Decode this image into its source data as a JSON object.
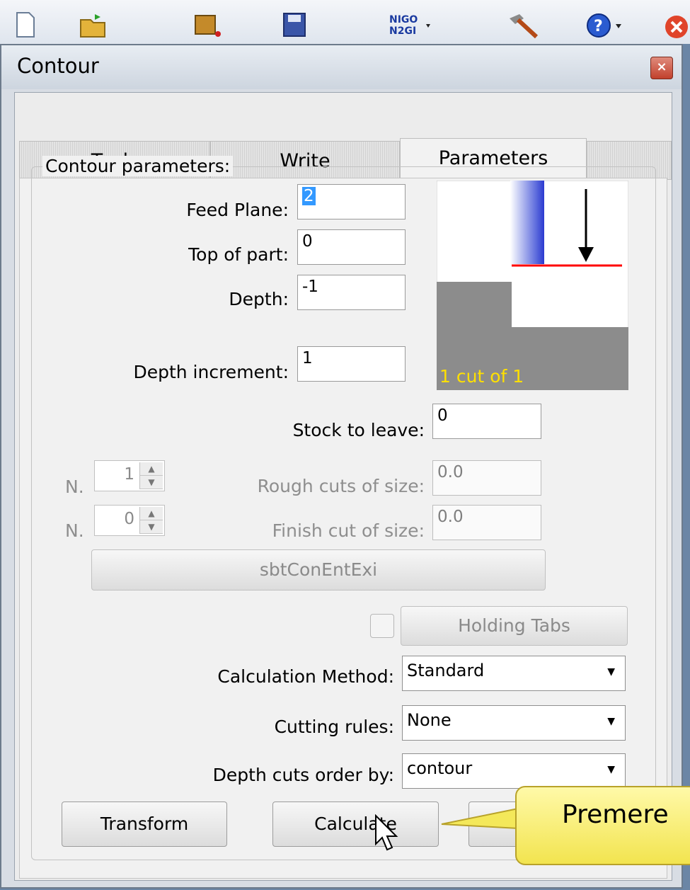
{
  "window": {
    "title": "Contour",
    "close_glyph": "×"
  },
  "tabs": [
    {
      "label": "Tools",
      "active": false
    },
    {
      "label": "Write",
      "active": false
    },
    {
      "label": "Parameters",
      "active": true
    }
  ],
  "group": {
    "title": "Contour parameters:"
  },
  "fields": {
    "feed_plane": {
      "label": "Feed Plane:",
      "value": "2"
    },
    "top_of_part": {
      "label": "Top of part:",
      "value": "0"
    },
    "depth": {
      "label": "Depth:",
      "value": "-1"
    },
    "depth_increment": {
      "label": "Depth increment:",
      "value": "1"
    },
    "stock_to_leave": {
      "label": "Stock to leave:",
      "value": "0"
    },
    "rough_cuts": {
      "label": "Rough cuts of size:",
      "value": "0.0",
      "n_label": "N.",
      "n_value": "1"
    },
    "finish_cut": {
      "label": "Finish cut of size:",
      "value": "0.0",
      "n_label": "N.",
      "n_value": "0"
    }
  },
  "preview": {
    "caption": "1 cut of 1"
  },
  "buttons": {
    "entry_exit": "sbtConEntExi",
    "holding_tabs": "Holding Tabs",
    "transform": "Transform",
    "calculate": "Calculate"
  },
  "combos": {
    "calculation_method": {
      "label": "Calculation Method:",
      "value": "Standard"
    },
    "cutting_rules": {
      "label": "Cutting rules:",
      "value": "None"
    },
    "depth_cuts_order": {
      "label": "Depth cuts order by:",
      "value": "contour"
    }
  },
  "callout": {
    "text": "Premere"
  },
  "colors": {
    "accent": "#3399ff",
    "callout": "#f2e44f",
    "preview_grey": "#8c8c8c",
    "preview_caption": "#ffe000",
    "red_line": "#ff0000"
  }
}
